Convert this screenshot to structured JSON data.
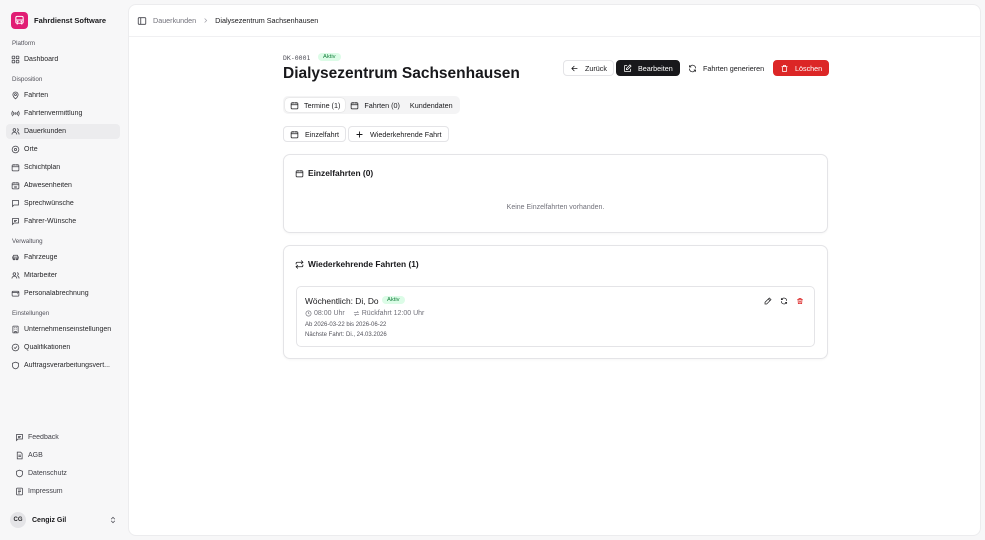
{
  "sidebar": {
    "brand": "Fahrdienst Software",
    "sections": {
      "platform": "Platform",
      "disposition": "Disposition",
      "verwaltung": "Verwaltung",
      "einstellungen": "Einstellungen"
    },
    "items": {
      "dashboard": "Dashboard",
      "fahrten": "Fahrten",
      "fahrtenvermittlung": "Fahrtenvermittlung",
      "dauerkunden": "Dauerkunden",
      "orte": "Orte",
      "schichtplan": "Schichtplan",
      "abwesenheiten": "Abwesenheiten",
      "sprechwuensche": "Sprechwünsche",
      "fahrer_wuensche": "Fahrer-Wünsche",
      "fahrzeuge": "Fahrzeuge",
      "mitarbeiter": "Mitarbeiter",
      "personalabrechnung": "Personalabrechnung",
      "unternehmenseinstellungen": "Unternehmenseinstellungen",
      "qualifikationen": "Qualifikationen",
      "auftragsverarbeitung": "Auftragsverarbeitungsvert..."
    },
    "footer": {
      "feedback": "Feedback",
      "agb": "AGB",
      "datenschutz": "Datenschutz",
      "impressum": "Impressum"
    },
    "user": {
      "initials": "CG",
      "name": "Cengiz Gil"
    }
  },
  "breadcrumb": {
    "parent": "Dauerkunden",
    "current": "Dialysezentrum Sachsenhausen"
  },
  "header": {
    "code": "DK-0001",
    "status": "Aktiv",
    "title": "Dialysezentrum Sachsenhausen",
    "actions": {
      "back": "Zurück",
      "edit": "Bearbeiten",
      "generate": "Fahrten generieren",
      "delete": "Löschen"
    }
  },
  "tabs": {
    "termine": "Termine (1)",
    "fahrten": "Fahrten (0)",
    "kundendaten": "Kundendaten"
  },
  "add_buttons": {
    "single": "Einzelfahrt",
    "recurring": "Wiederkehrende Fahrt"
  },
  "single_rides": {
    "title": "Einzelfahrten (0)",
    "empty": "Keine Einzelfahrten vorhanden."
  },
  "recurring_rides": {
    "title": "Wiederkehrende Fahrten (1)",
    "items": [
      {
        "title": "Wöchentlich: Di, Do",
        "status": "Aktiv",
        "time": "08:00 Uhr",
        "return": "Rückfahrt 12:00 Uhr",
        "period": "Ab 2026-03-22 bis 2026-06-22",
        "next": "Nächste Fahrt: Di., 24.03.2026"
      }
    ]
  },
  "colors": {
    "brand": "#e11d74",
    "primary": "#18181b",
    "danger": "#dc2626",
    "success_text": "#15803d",
    "success_bg": "#dcfce7"
  }
}
